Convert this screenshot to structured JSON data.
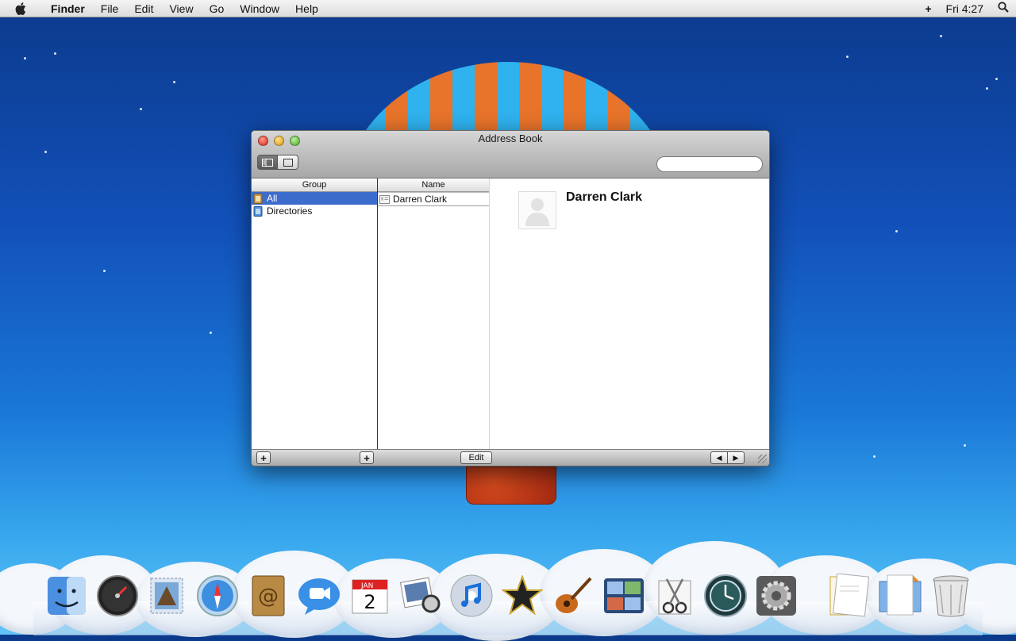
{
  "menubar": {
    "app_name": "Finder",
    "items": [
      "File",
      "Edit",
      "View",
      "Go",
      "Window",
      "Help"
    ],
    "clock": "Fri 4:27"
  },
  "window": {
    "title": "Address Book",
    "search": {
      "value": "",
      "placeholder": ""
    },
    "group_column": {
      "header": "Group",
      "items": [
        {
          "label": "All",
          "selected": true
        },
        {
          "label": "Directories",
          "selected": false
        }
      ]
    },
    "name_column": {
      "header": "Name",
      "items": [
        {
          "label": "Darren Clark"
        }
      ]
    },
    "card": {
      "name": "Darren Clark"
    },
    "bottombar": {
      "add_group": "+",
      "add_person": "+",
      "edit_label": "Edit",
      "prev": "◀",
      "next": "▶"
    }
  },
  "dock": {
    "items": [
      "finder-icon",
      "dashboard-icon",
      "mail-icon",
      "safari-icon",
      "address-book-icon",
      "ichat-icon",
      "ical-icon",
      "preview-icon",
      "itunes-icon",
      "imovie-icon",
      "garageband-icon",
      "spaces-icon",
      "scissors-icon",
      "time-machine-icon",
      "system-preferences-icon",
      "documents-stack-icon",
      "downloads-stack-icon",
      "trash-icon"
    ],
    "ical_month": "JAN",
    "ical_day": "2"
  }
}
